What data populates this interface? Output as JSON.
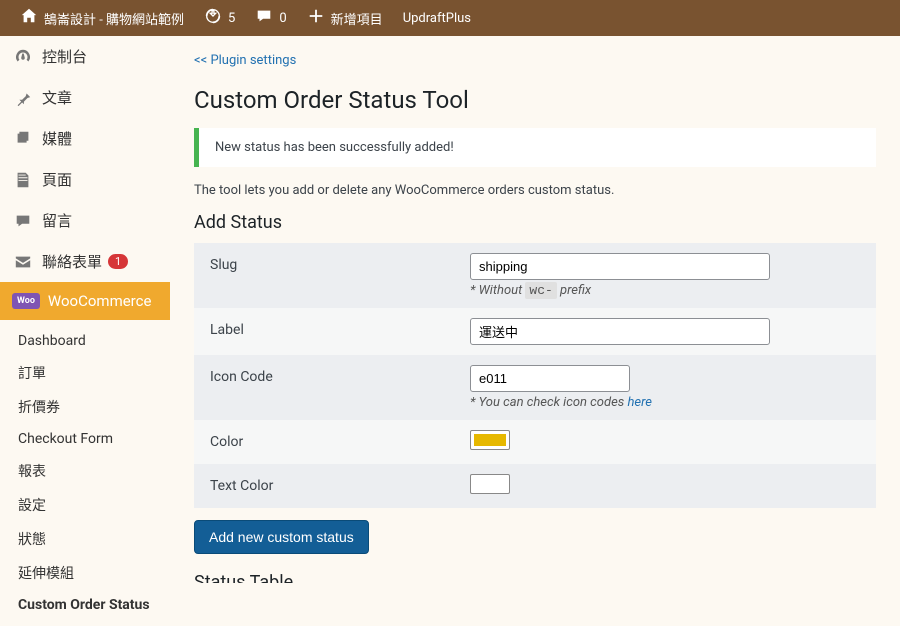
{
  "adminBar": {
    "siteName": "鵠崙設計 - 購物網站範例",
    "updates": "5",
    "comments": "0",
    "newItem": "新增項目",
    "plugin": "UpdraftPlus"
  },
  "sidebar": {
    "dashboard": "控制台",
    "posts": "文章",
    "media": "媒體",
    "pages": "頁面",
    "comments": "留言",
    "contact": "聯絡表單",
    "contactBadge": "1",
    "woo": "WooCommerce",
    "submenu": {
      "dashboard": "Dashboard",
      "orders": "訂單",
      "coupons": "折價券",
      "checkout": "Checkout Form",
      "reports": "報表",
      "settings": "設定",
      "status": "狀態",
      "extensions": "延伸模組",
      "customStatus": "Custom Order Status"
    }
  },
  "main": {
    "backLink": "<< Plugin settings",
    "title": "Custom Order Status Tool",
    "success": "New status has been successfully added!",
    "intro": "The tool lets you add or delete any WooCommerce orders custom status.",
    "addHeading": "Add Status",
    "fields": {
      "slugLabel": "Slug",
      "slugValue": "shipping",
      "slugHint1": "* Without ",
      "slugHintCode": "wc-",
      "slugHint2": " prefix",
      "labelLabel": "Label",
      "labelValue": "運送中",
      "iconLabel": "Icon Code",
      "iconValue": "e011",
      "iconHint": "* You can check icon codes ",
      "iconHintLink": "here",
      "colorLabel": "Color",
      "colorValue": "#e6b800",
      "textColorLabel": "Text Color",
      "textColorValue": "#ffffff"
    },
    "submit": "Add new custom status",
    "statusTableHeading": "Status Table"
  }
}
